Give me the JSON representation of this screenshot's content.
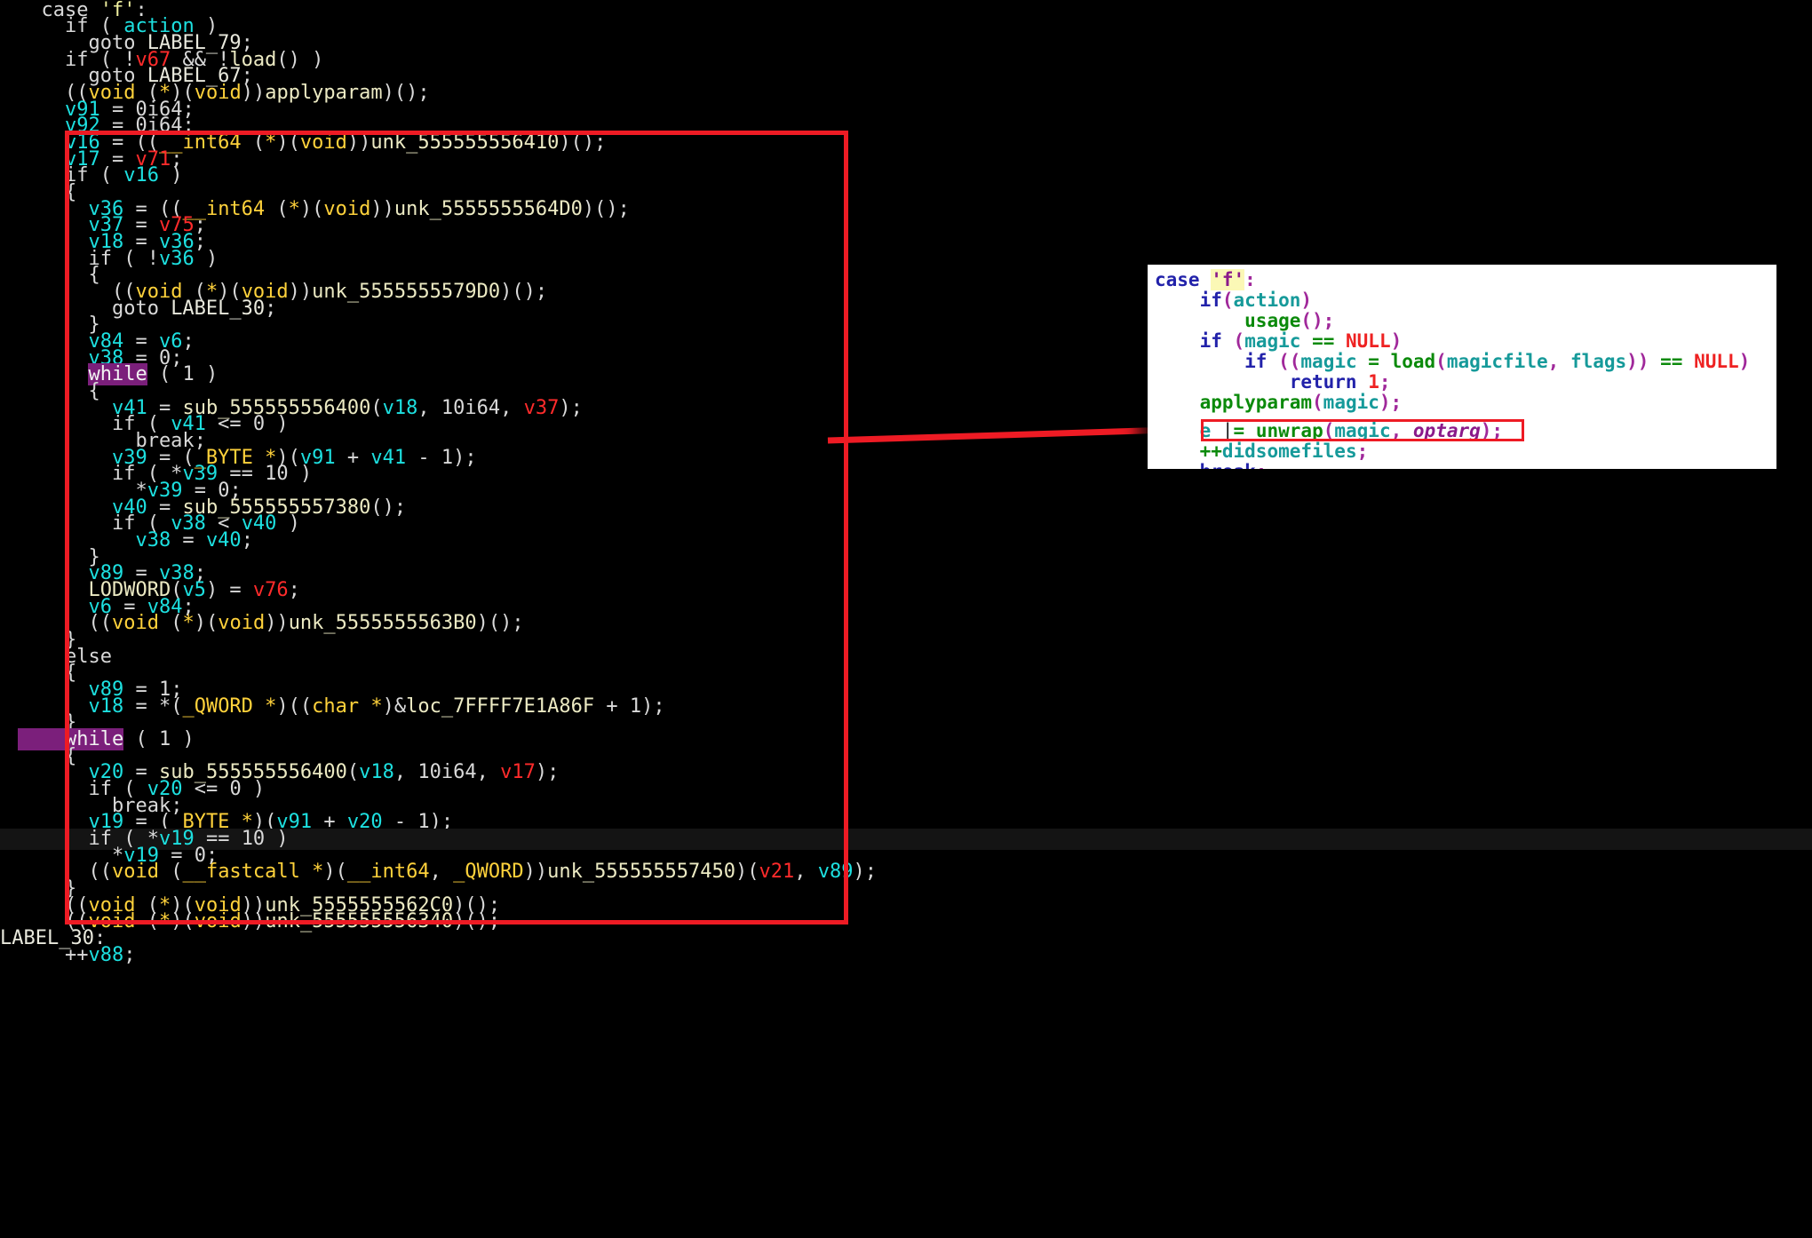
{
  "app": {
    "kind": "decompiler-pseudocode-view",
    "background_color": "#000000",
    "accent_annotation_color": "#ee1b24"
  },
  "theme": {
    "local_var_color": "#1de0e0",
    "argument_color": "#ff2b2b",
    "type_color": "#ffd23b",
    "symbol_color": "#eceac3",
    "default_text_color": "#d9d9d9",
    "keyword_highlight_bg": "#7b1f7b",
    "cursor_line_bg": "#141414"
  },
  "pseudocode": {
    "lines": [
      "  case 'f':",
      "    if ( action )",
      "      goto LABEL_79;",
      "    if ( !v67 && !load() )",
      "      goto LABEL_67;",
      "    ((void (*)(void))applyparam)();",
      "    v91 = 0i64;",
      "    v92 = 0i64;",
      "    v16 = ((__int64 (*)(void))unk_555555556410)();",
      "    v17 = v71;",
      "    if ( v16 )",
      "    {",
      "      v36 = ((__int64 (*)(void))unk_5555555564D0)();",
      "      v37 = v75;",
      "      v18 = v36;",
      "      if ( !v36 )",
      "      {",
      "        ((void (*)(void))unk_5555555579D0)();",
      "        goto LABEL_30;",
      "      }",
      "      v84 = v6;",
      "      v38 = 0;",
      "      while ( 1 )",
      "      {",
      "        v41 = sub_555555556400(v18, 10i64, v37);",
      "        if ( v41 <= 0 )",
      "          break;",
      "        v39 = (_BYTE *)(v91 + v41 - 1);",
      "        if ( *v39 == 10 )",
      "          *v39 = 0;",
      "        v40 = sub_555555557380();",
      "        if ( v38 < v40 )",
      "          v38 = v40;",
      "      }",
      "      v89 = v38;",
      "      LODWORD(v5) = v76;",
      "      v6 = v84;",
      "      ((void (*)(void))unk_5555555563B0)();",
      "    }",
      "    else",
      "    {",
      "      v89 = 1;",
      "      v18 = *(_QWORD *)((char *)&loc_7FFFF7E1A86F + 1);",
      "    }",
      "    while ( 1 )",
      "    {",
      "      v20 = sub_555555556400(v18, 10i64, v17);",
      "      if ( v20 <= 0 )",
      "        break;",
      "      v19 = (_BYTE *)(v91 + v20 - 1);",
      "      if ( *v19 == 10 )",
      "        *v19 = 0;",
      "      ((void (__fastcall *)(__int64, _QWORD))unk_555555557450)(v21, v89);",
      "    }",
      "    ((void (*)(void))unk_5555555562C0)();",
      "    ((void (*)(void))unk_555555556340)();",
      "LABEL_30:",
      "    ++v88;"
    ],
    "cursor_line_index": 52,
    "highlighted_keyword": "while",
    "labels": [
      "LABEL_79",
      "LABEL_67",
      "LABEL_30"
    ],
    "symbols": [
      "unk_555555556410",
      "unk_5555555564D0",
      "unk_5555555579D0",
      "sub_555555556400",
      "sub_555555557380",
      "unk_5555555563B0",
      "loc_7FFFF7E1A86F",
      "unk_555555557450",
      "unk_5555555562C0",
      "unk_555555556340"
    ],
    "locals": [
      "v91",
      "v92",
      "v16",
      "v17",
      "v36",
      "v37",
      "v18",
      "v84",
      "v6",
      "v38",
      "v41",
      "v39",
      "v40",
      "v89",
      "v5",
      "v20",
      "v19",
      "v88",
      "v92"
    ],
    "arguments": [
      "v67",
      "v71",
      "v75",
      "v76",
      "v21",
      "v17",
      "v37"
    ]
  },
  "annotation": {
    "box_label": "red-highlight-box",
    "arrow_label": "correspondence-arrow",
    "arrow_color": "#ee1b24"
  },
  "inset": {
    "title": "original-source-snippet",
    "background_color": "#ffffff",
    "lines": [
      "case 'f':",
      "    if(action)",
      "        usage();",
      "    if (magic == NULL)",
      "        if ((magic = load(magicfile, flags)) == NULL)",
      "            return 1;",
      "    applyparam(magic);",
      "    e |= unwrap(magic, optarg);",
      "    ++didsomefiles;",
      "    break;"
    ],
    "highlighted_line": "e |= unwrap(magic, optarg);",
    "highlighted_line_index": 7,
    "string_literal": "'f'",
    "keywords": [
      "case",
      "if",
      "return",
      "break"
    ],
    "functions": [
      "usage",
      "load",
      "applyparam",
      "unwrap"
    ],
    "identifiers": [
      "action",
      "magic",
      "magicfile",
      "flags",
      "e",
      "optarg",
      "didsomefiles"
    ],
    "constants": [
      "NULL",
      "1"
    ]
  }
}
